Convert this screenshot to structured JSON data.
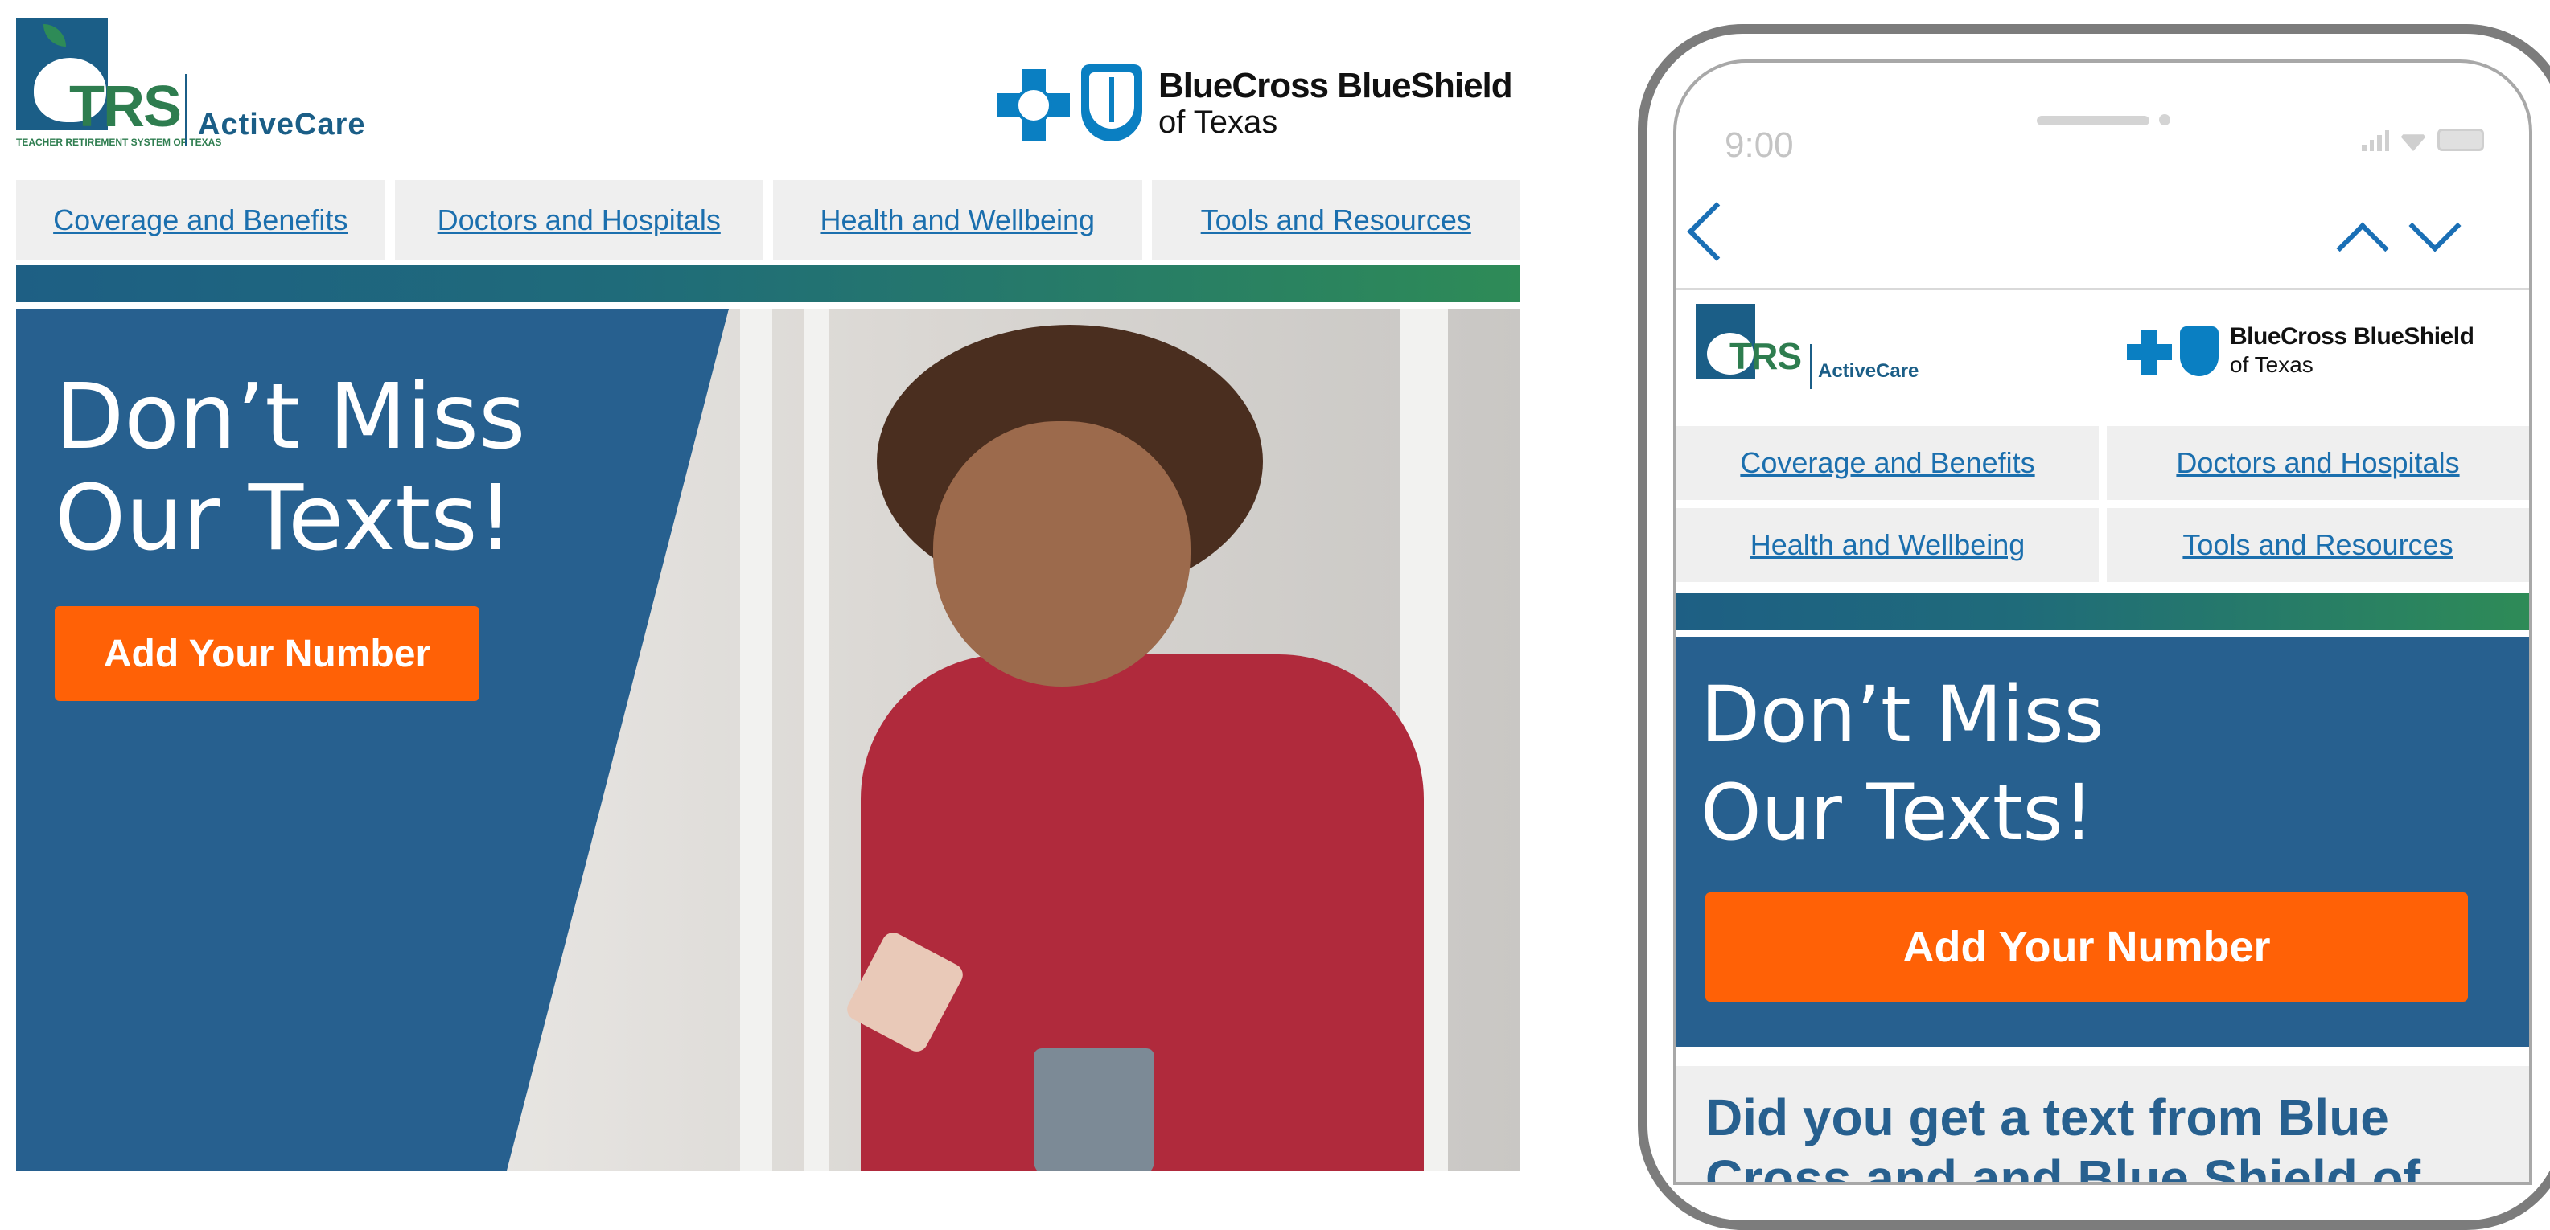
{
  "desktop": {
    "trs_logo": {
      "name": "TRS",
      "product": "ActiveCare",
      "tagline": "TEACHER RETIREMENT SYSTEM OF TEXAS"
    },
    "bcbs_logo": {
      "name": "BlueCross BlueShield",
      "region": "of Texas"
    },
    "nav": [
      {
        "label": "Coverage and Benefits"
      },
      {
        "label": "Doctors and Hospitals"
      },
      {
        "label": "Health and Wellbeing"
      },
      {
        "label": "Tools and Resources"
      }
    ],
    "hero": {
      "title_line1": "Don’t Miss",
      "title_line2": "Our Texts!",
      "cta": "Add Your Number"
    }
  },
  "mobile": {
    "status_time": "9:00",
    "trs_logo": {
      "name": "TRS",
      "product": "ActiveCare"
    },
    "bcbs_logo": {
      "name": "BlueCross BlueShield",
      "region": "of Texas"
    },
    "nav": [
      {
        "label": "Coverage and Benefits"
      },
      {
        "label": "Doctors and Hospitals"
      },
      {
        "label": "Health and Wellbeing"
      },
      {
        "label": "Tools and Resources"
      }
    ],
    "hero": {
      "title_line1": "Don’t Miss",
      "title_line2": "Our Texts!",
      "cta": "Add Your Number"
    },
    "question": "Did you get a text from Blue Cross and and Blue Shield of"
  },
  "colors": {
    "brand_blue": "#27608f",
    "link_blue": "#1b6fae",
    "cta_orange": "#ff6106",
    "trs_green": "#2e7d4f"
  }
}
